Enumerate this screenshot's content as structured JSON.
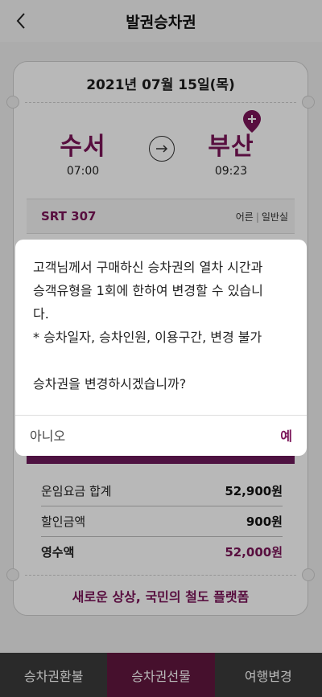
{
  "header": {
    "title": "발권승차권",
    "back_icon": "chevron-left-icon"
  },
  "ticket": {
    "date": "2021년 07월 15일(목)",
    "departure": {
      "station": "수서",
      "time": "07:00"
    },
    "arrival": {
      "station": "부산",
      "time": "09:23"
    },
    "train_no": "SRT 307",
    "passenger_type": "어른",
    "seat_class": "일반실",
    "fares": [
      {
        "label": "운임요금 합계",
        "value": "52,900원"
      },
      {
        "label": "할인금액",
        "value": "900원"
      },
      {
        "label": "영수액",
        "value": "52,000원"
      }
    ],
    "slogan": "새로운 상상, 국민의 철도 플랫폼"
  },
  "dialog": {
    "line1": "고객님께서 구매하신 승차권의 열차 시간과",
    "line2": "승객유형을 1회에 한하여 변경할 수 있습니",
    "line3": "다.",
    "line4": "* 승차일자, 승차인원, 이용구간, 변경 불가",
    "question": "승차권을 변경하시겠습니까?",
    "no_label": "아니오",
    "yes_label": "예"
  },
  "tabs": [
    {
      "label": "승차권환불"
    },
    {
      "label": "승차권선물"
    },
    {
      "label": "여행변경"
    }
  ],
  "colors": {
    "brand": "#7a1458",
    "tab_active": "#62173f",
    "tab_bg": "#3b3b3b"
  }
}
